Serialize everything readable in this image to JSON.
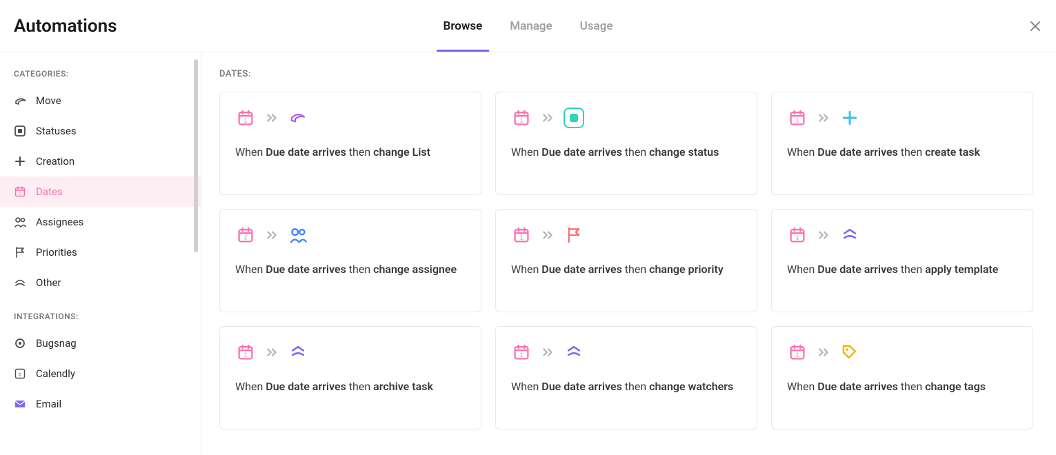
{
  "header": {
    "title": "Automations",
    "tabs": [
      "Browse",
      "Manage",
      "Usage"
    ],
    "active_tab": 0
  },
  "sidebar": {
    "heading_categories": "CATEGORIES:",
    "heading_integrations": "INTEGRATIONS:",
    "categories": [
      {
        "label": "Move",
        "icon": "share-icon"
      },
      {
        "label": "Statuses",
        "icon": "status-icon"
      },
      {
        "label": "Creation",
        "icon": "plus-icon"
      },
      {
        "label": "Dates",
        "icon": "calendar-icon"
      },
      {
        "label": "Assignees",
        "icon": "people-icon"
      },
      {
        "label": "Priorities",
        "icon": "flag-icon"
      },
      {
        "label": "Other",
        "icon": "other-icon"
      }
    ],
    "active_category": 3,
    "integrations": [
      {
        "label": "Bugsnag",
        "icon": "bugsnag-icon"
      },
      {
        "label": "Calendly",
        "icon": "calendly-icon"
      },
      {
        "label": "Email",
        "icon": "email-icon"
      }
    ]
  },
  "section": {
    "heading": "DATES:"
  },
  "cards": [
    {
      "when_prefix": "When ",
      "trigger": "Due date arrives",
      "then": " then ",
      "action": "change List",
      "action_icon": "share-purple-icon"
    },
    {
      "when_prefix": "When ",
      "trigger": "Due date arrives",
      "then": " then ",
      "action": "change status",
      "action_icon": "status-green-icon"
    },
    {
      "when_prefix": "When ",
      "trigger": "Due date arrives",
      "then": " then ",
      "action": "create task",
      "action_icon": "plus-blue-icon"
    },
    {
      "when_prefix": "When ",
      "trigger": "Due date arrives",
      "then": " then ",
      "action": "change assignee",
      "action_icon": "people-blue-icon"
    },
    {
      "when_prefix": "When ",
      "trigger": "Due date arrives",
      "then": " then ",
      "action": "change priority",
      "action_icon": "flag-red-icon"
    },
    {
      "when_prefix": "When ",
      "trigger": "Due date arrives",
      "then": " then ",
      "action": "apply template",
      "action_icon": "template-purple-icon"
    },
    {
      "when_prefix": "When ",
      "trigger": "Due date arrives",
      "then": " then ",
      "action": "archive task",
      "action_icon": "archive-purple-icon"
    },
    {
      "when_prefix": "When ",
      "trigger": "Due date arrives",
      "then": " then ",
      "action": "change watchers",
      "action_icon": "watchers-purple-icon"
    },
    {
      "when_prefix": "When ",
      "trigger": "Due date arrives",
      "then": " then ",
      "action": "change tags",
      "action_icon": "tag-yellow-icon"
    }
  ]
}
